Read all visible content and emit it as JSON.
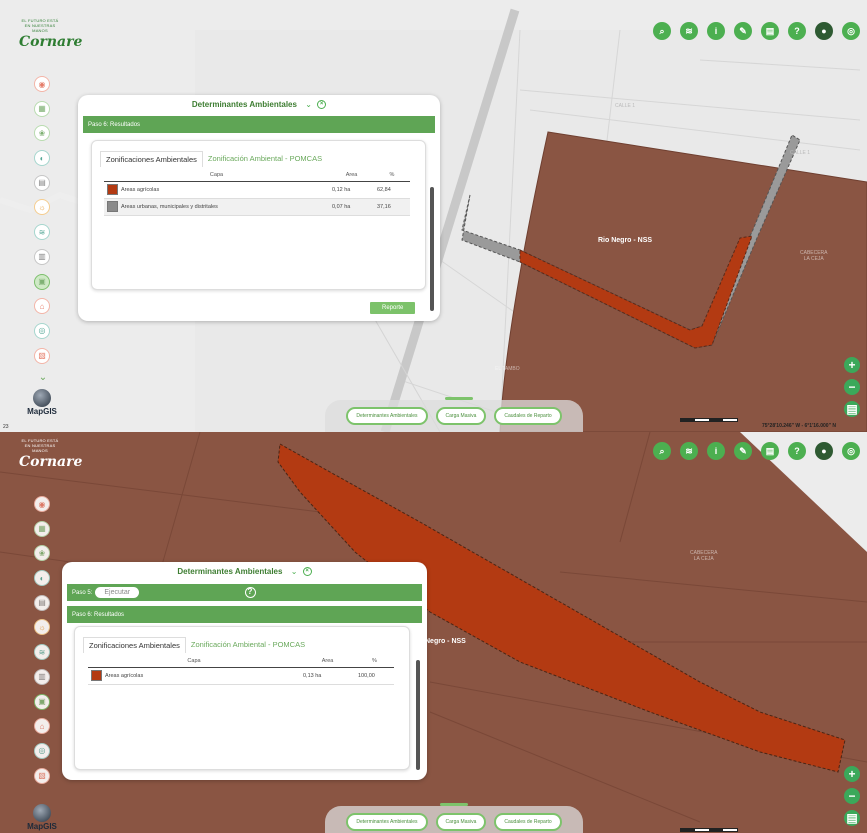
{
  "logo": {
    "arc": "EL FUTURO ESTÁ EN NUESTRAS MANOS",
    "text": "Cornare"
  },
  "colors": {
    "agricola": "#b33a12",
    "urbana": "#8a8a8a",
    "brand_green": "#4caf50",
    "map_brown": "#8a5543"
  },
  "toolbar_icons": [
    "search-icon",
    "layers-icon",
    "info-icon",
    "measure-icon",
    "print-icon",
    "help-icon",
    "basemap-icon",
    "user-icon"
  ],
  "rail_icons": [
    "rail-1",
    "rail-2",
    "rail-3",
    "rail-4",
    "rail-5",
    "rail-6",
    "rail-7",
    "rail-8",
    "rail-9",
    "rail-10",
    "rail-11",
    "rail-12"
  ],
  "mapgis": "MapGIS",
  "tabbar": {
    "t1": "Determinantes Ambientales",
    "t2": "Carga Masiva",
    "t3": "Caudales de Reparto"
  },
  "top": {
    "panel_title": "Determinantes Ambientales",
    "step_label": "Paso 6: Resultados",
    "tab_active": "Zonificaciones Ambientales",
    "tab_other": "Zonificación Ambiental - POMCAS",
    "columns": {
      "capa": "Capa",
      "area": "Area",
      "pct": "%"
    },
    "rows": [
      {
        "capa": "Areas agrícolas",
        "area": "0,12 ha",
        "pct": "62,84",
        "color": "#b33a12"
      },
      {
        "capa": "Areas urbanas, municipales y distritales",
        "area": "0,07 ha",
        "pct": "37,16",
        "color": "#8a8a8a"
      }
    ],
    "report_btn": "Reporte",
    "map_label": "Rio Negro - NSS",
    "street_1": "CALLE 1",
    "street_2": "CALLE 1",
    "cabecera": "CABECERA",
    "cabecera_sub": "LA CEJA",
    "el_tambo": "EL TAMBO",
    "coords": "75°28'10.246\" W - 6°1'16.000\" N",
    "corner_num": "23"
  },
  "bottom": {
    "panel_title": "Determinantes Ambientales",
    "step5_label": "Paso 5:",
    "exec_btn": "Ejecutar",
    "help_glyph": "?",
    "step6_label": "Paso 6: Resultados",
    "tab_active": "Zonificaciones Ambientales",
    "tab_other": "Zonificación Ambiental - POMCAS",
    "columns": {
      "capa": "Capa",
      "area": "Area",
      "pct": "%"
    },
    "rows": [
      {
        "capa": "Areas agrícolas",
        "area": "0,13 ha",
        "pct": "100,00",
        "color": "#b33a12"
      }
    ],
    "map_label": "Negro - NSS",
    "cabecera": "CABECERA",
    "cabecera_sub": "LA CEJA"
  }
}
